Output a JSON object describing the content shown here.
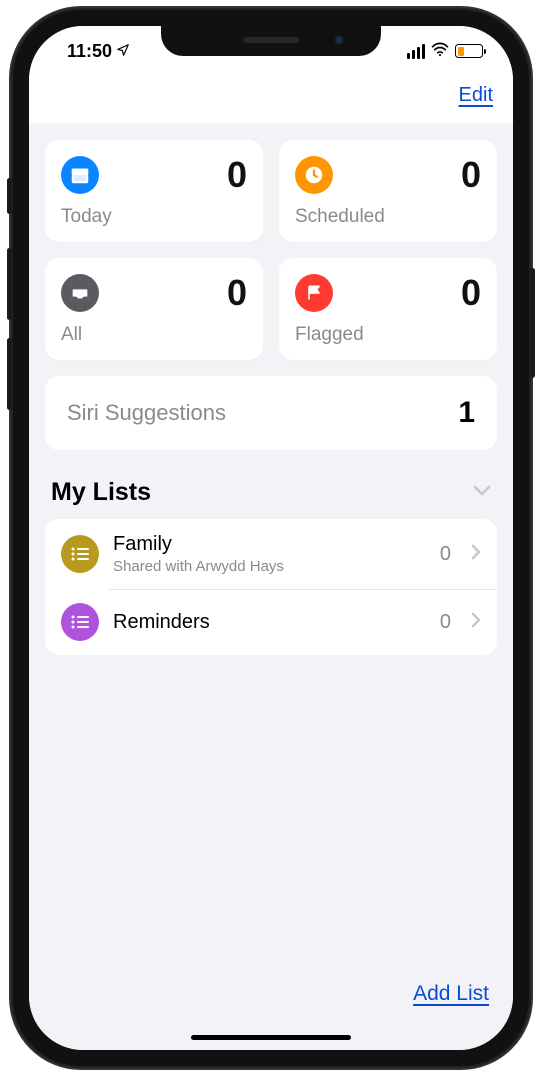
{
  "status": {
    "time": "11:50"
  },
  "nav": {
    "edit": "Edit"
  },
  "cards": {
    "today": {
      "label": "Today",
      "count": "0",
      "color": "#0a84ff"
    },
    "scheduled": {
      "label": "Scheduled",
      "count": "0",
      "color": "#ff9500"
    },
    "all": {
      "label": "All",
      "count": "0",
      "color": "#5b5b5f"
    },
    "flagged": {
      "label": "Flagged",
      "count": "0",
      "color": "#ff3b30"
    }
  },
  "siri": {
    "label": "Siri Suggestions",
    "count": "1"
  },
  "lists": {
    "title": "My Lists",
    "items": [
      {
        "name": "Family",
        "subtitle": "Shared with Arwydd Hays",
        "count": "0",
        "color": "#b89a1e"
      },
      {
        "name": "Reminders",
        "subtitle": "",
        "count": "0",
        "color": "#af52de"
      }
    ]
  },
  "toolbar": {
    "addList": "Add List"
  }
}
